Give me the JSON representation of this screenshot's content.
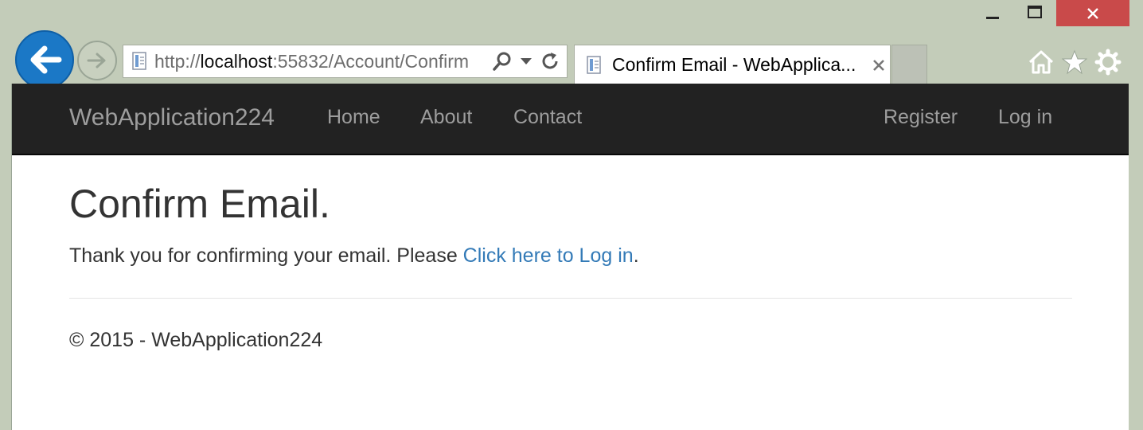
{
  "browser": {
    "url_prefix": "http://",
    "url_host": "localhost",
    "url_rest": ":55832/Account/Confirm",
    "tab_title": "Confirm Email - WebApplication224",
    "tab_title_shown": "Confirm Email - WebApplica..."
  },
  "navbar": {
    "brand": "WebApplication224",
    "links": [
      "Home",
      "About",
      "Contact"
    ],
    "right_links": [
      "Register",
      "Log in"
    ]
  },
  "main": {
    "title": "Confirm Email.",
    "message_prefix": "Thank you for confirming your email. Please ",
    "link_text": "Click here to Log in",
    "message_suffix": "."
  },
  "footer": {
    "text": "© 2015 - WebApplication224"
  },
  "icons": [
    "minimize-icon",
    "maximize-icon",
    "close-icon",
    "back-arrow-icon",
    "forward-arrow-icon",
    "page-icon",
    "search-icon",
    "dropdown-icon",
    "refresh-icon",
    "tab-close-icon",
    "home-icon",
    "favorites-star-icon",
    "settings-gear-icon"
  ],
  "colors": {
    "chrome": "#c3ccb9",
    "close_button": "#c94a4a",
    "back_button": "#1b78c6",
    "navbar_bg": "#222222",
    "navbar_text": "#9d9d9d",
    "link": "#337ab7",
    "text": "#333333"
  }
}
